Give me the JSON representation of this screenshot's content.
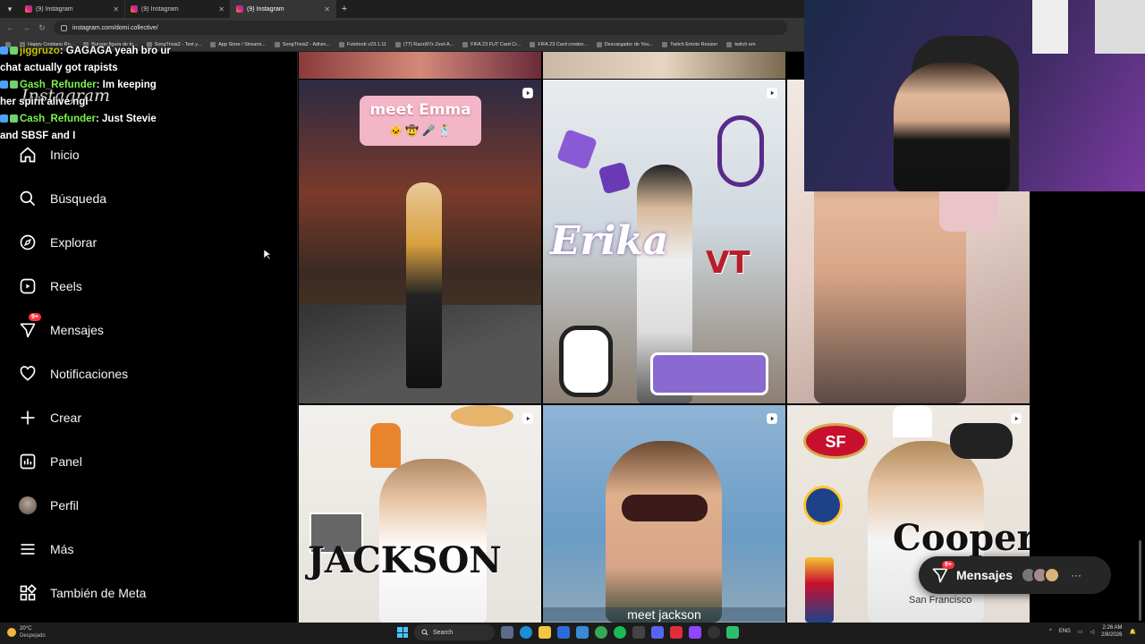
{
  "browser": {
    "tabs": [
      {
        "title": "(9) Instagram",
        "active": false
      },
      {
        "title": "(9) Instagram",
        "active": false
      },
      {
        "title": "(9) Instagram",
        "active": true
      }
    ],
    "new_tab_icon": "plus-icon",
    "url": "instagram.com/domi.collective/",
    "bookmarks": [
      "Happy Cristiano Ro...",
      "Burago figura de to...",
      "SongTrivia2 - Test y...",
      "App Store / Streami...",
      "SongTrivia2 - Adivin...",
      "Futetoob v23.1.11",
      "(77) Razzi97z Zest-A...",
      "FIFA 23 FUT Card Cr...",
      "FIFA 23 Card creator...",
      "Descargador de You...",
      "Twitch Emote Resizer",
      "twitch em"
    ]
  },
  "chat": {
    "messages": [
      {
        "user": "jiggruzo",
        "text": ": GAGAGA yeah bro ur",
        "cont": "chat actually got rapists"
      },
      {
        "user": "Gash_Refunder",
        "text": ": Im keeping",
        "cont": "her spirit alive ngl"
      },
      {
        "user": "Cash_Refunder",
        "text": ": Just Stevie",
        "cont": "and SBSF and I"
      }
    ]
  },
  "sidebar": {
    "logo": "Instagram",
    "items": [
      {
        "label": "Inicio",
        "icon": "home-icon"
      },
      {
        "label": "Búsqueda",
        "icon": "search-icon"
      },
      {
        "label": "Explorar",
        "icon": "compass-icon"
      },
      {
        "label": "Reels",
        "icon": "reels-icon"
      },
      {
        "label": "Mensajes",
        "icon": "messenger-icon",
        "badge": "9+"
      },
      {
        "label": "Notificaciones",
        "icon": "heart-icon"
      },
      {
        "label": "Crear",
        "icon": "plus-icon"
      },
      {
        "label": "Panel",
        "icon": "chart-icon"
      },
      {
        "label": "Perfil",
        "icon": "avatar"
      },
      {
        "label": "Más",
        "icon": "menu-icon"
      },
      {
        "label": "También de Meta",
        "icon": "meta-apps-icon"
      }
    ]
  },
  "grid": {
    "posts": [
      {
        "caption": "meet Emma",
        "emoji_row": "🐱 🤠 🎤 🕺"
      },
      {
        "caption": "Erika",
        "badge": "VT"
      },
      {
        "caption": ""
      },
      {
        "caption": "JACKSON"
      },
      {
        "caption": "meet jackson"
      },
      {
        "caption": "Cooper",
        "sub": "San Francisco",
        "badge": "SF"
      }
    ]
  },
  "messages_pill": {
    "label": "Mensajes",
    "badge": "9+",
    "more": "···"
  },
  "taskbar": {
    "temperature": "20°C",
    "weather": "Despejado",
    "search": "Search",
    "lang": "ENG",
    "time": "2:26 AM",
    "date": "2/8/2026"
  },
  "colors": {
    "chat_user": "#7df14a",
    "badge": "#ff3040",
    "bg": "#000000"
  }
}
